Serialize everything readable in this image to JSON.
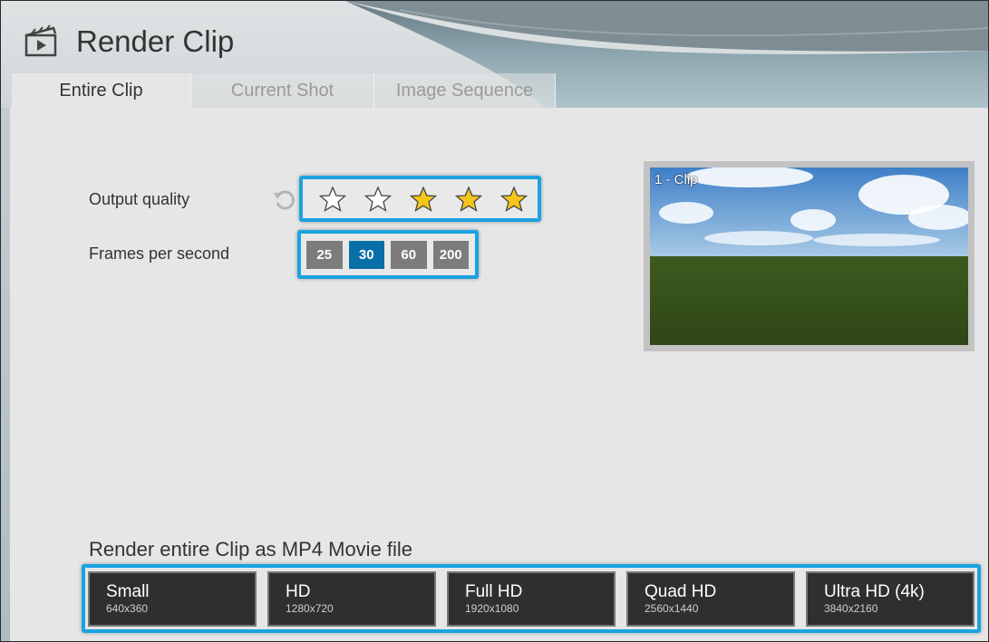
{
  "window": {
    "title": "Render Clip"
  },
  "tabs": [
    {
      "label": "Entire Clip",
      "active": true
    },
    {
      "label": "Current Shot",
      "active": false
    },
    {
      "label": "Image Sequence",
      "active": false
    }
  ],
  "settings": {
    "quality_label": "Output quality",
    "quality_rating": 3,
    "quality_max": 5,
    "fps_label": "Frames per second",
    "fps_options": [
      "25",
      "30",
      "60",
      "200"
    ],
    "fps_selected": "30"
  },
  "preview": {
    "label": "1 - Clip"
  },
  "export": {
    "title": "Render entire Clip as MP4 Movie file",
    "resolutions": [
      {
        "name": "Small",
        "size": "640x360"
      },
      {
        "name": "HD",
        "size": "1280x720"
      },
      {
        "name": "Full HD",
        "size": "1920x1080"
      },
      {
        "name": "Quad HD",
        "size": "2560x1440"
      },
      {
        "name": "Ultra HD (4k)",
        "size": "3840x2160"
      }
    ]
  },
  "colors": {
    "highlight": "#1aa3e0",
    "fps_active": "#0a6fa8",
    "star_filled": "#f5c518"
  }
}
